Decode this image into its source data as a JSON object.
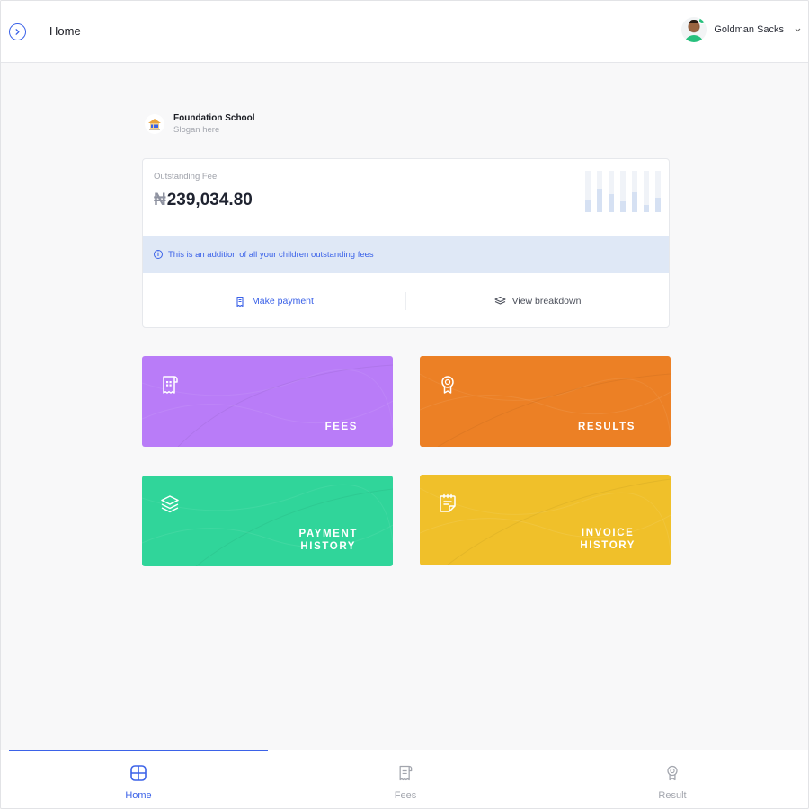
{
  "header": {
    "title": "Home",
    "user_name": "Goldman Sacks",
    "user_online": true
  },
  "school": {
    "name": "Foundation School",
    "slogan": "Slogan here"
  },
  "fee_card": {
    "label": "Outstanding Fee",
    "currency_symbol": "₦",
    "amount": "239,034.80",
    "info_text": "This is an addition of all your children outstanding fees",
    "make_payment_label": "Make payment",
    "view_breakdown_label": "View breakdown"
  },
  "tiles": [
    {
      "key": "fees",
      "line1": "FEES",
      "line2": "",
      "icon": "receipt-icon",
      "color": "#b97cf8"
    },
    {
      "key": "results",
      "line1": "RESULTS",
      "line2": "",
      "icon": "award-icon",
      "color": "#ec8025"
    },
    {
      "key": "payment_history",
      "line1": "PAYMENT",
      "line2": "HISTORY",
      "icon": "layers-icon",
      "color": "#30d59a"
    },
    {
      "key": "invoice_history",
      "line1": "INVOICE",
      "line2": "HISTORY",
      "icon": "note-icon",
      "color": "#f0c02a"
    }
  ],
  "bottom_nav": {
    "items": [
      {
        "label": "Home",
        "icon": "home-grid-icon",
        "active": true
      },
      {
        "label": "Fees",
        "icon": "receipt-icon",
        "active": false
      },
      {
        "label": "Result",
        "icon": "award-icon",
        "active": false
      }
    ]
  },
  "colors": {
    "accent": "#3b62e8",
    "info_bg": "#dfe8f6",
    "online": "#27c07d"
  }
}
